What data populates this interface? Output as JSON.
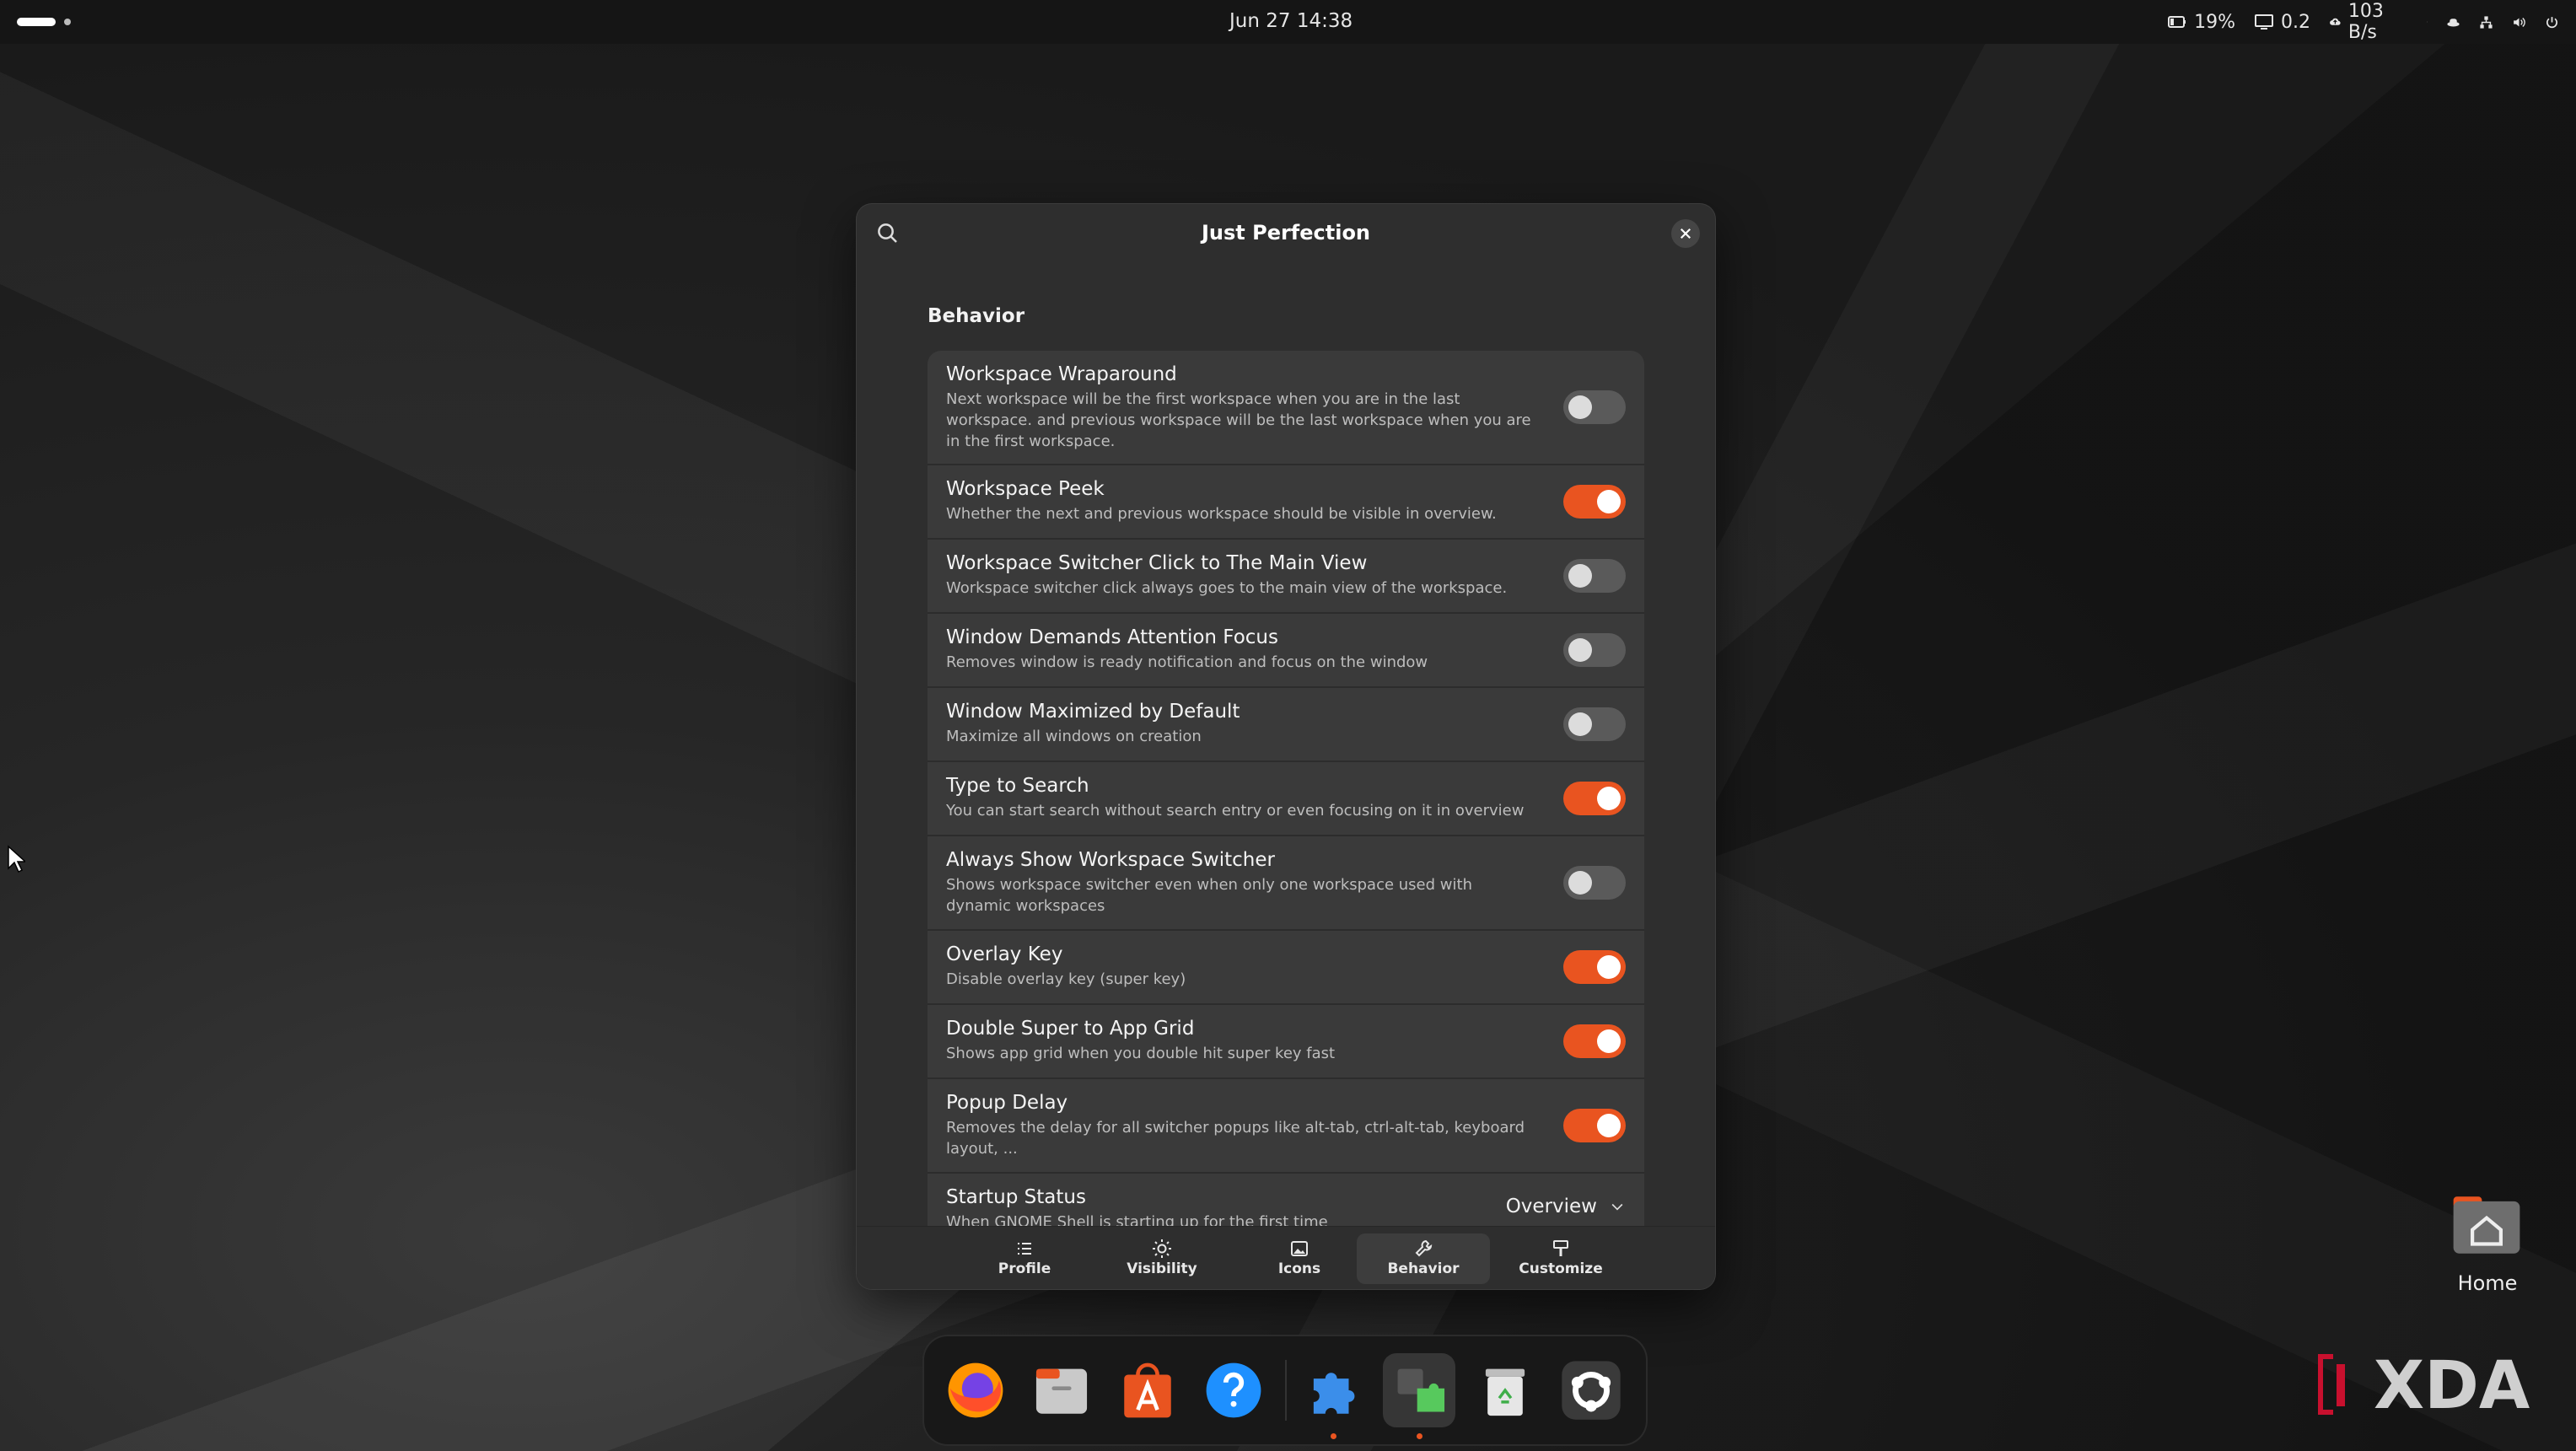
{
  "topbar": {
    "clock": "Jun 27  14:38",
    "status": [
      {
        "icon": "battery-icon",
        "text": "19%"
      },
      {
        "icon": "display-icon",
        "text": "0.2"
      },
      {
        "icon": "cloud-upload-icon",
        "text": "103 B/s"
      }
    ],
    "tray_icons": [
      "screen-share-icon",
      "hat-icon",
      "network-icon",
      "volume-icon",
      "power-icon"
    ]
  },
  "dialog": {
    "title": "Just Perfection",
    "section": "Behavior",
    "rows": [
      {
        "title": "Workspace Wraparound",
        "subtitle": "Next workspace will be the first workspace when you are in the last workspace. and previous workspace will be the last workspace when you are in the first workspace.",
        "enabled": false
      },
      {
        "title": "Workspace Peek",
        "subtitle": "Whether the next and previous workspace should be visible in overview.",
        "enabled": true
      },
      {
        "title": "Workspace Switcher Click to The Main View",
        "subtitle": "Workspace switcher click always goes to the main view of the workspace.",
        "enabled": false
      },
      {
        "title": "Window Demands Attention Focus",
        "subtitle": "Removes window is ready notification and focus on the window",
        "enabled": false
      },
      {
        "title": "Window Maximized by Default",
        "subtitle": "Maximize all windows on creation",
        "enabled": false
      },
      {
        "title": "Type to Search",
        "subtitle": "You can start search without search entry or even focusing on it in overview",
        "enabled": true
      },
      {
        "title": "Always Show Workspace Switcher",
        "subtitle": "Shows workspace switcher even when only one workspace used with dynamic workspaces",
        "enabled": false
      },
      {
        "title": "Overlay Key",
        "subtitle": "Disable overlay key (super key)",
        "enabled": true
      },
      {
        "title": "Double Super to App Grid",
        "subtitle": "Shows app grid when you double hit super key fast",
        "enabled": true
      },
      {
        "title": "Popup Delay",
        "subtitle": "Removes the delay for all switcher popups like alt-tab, ctrl-alt-tab, keyboard layout, ...",
        "enabled": true
      }
    ],
    "startup": {
      "title": "Startup Status",
      "subtitle": "When GNOME Shell is starting up for the first time",
      "value": "Overview"
    },
    "tabs": [
      {
        "label": "Profile",
        "icon": "list-icon"
      },
      {
        "label": "Visibility",
        "icon": "sun-icon"
      },
      {
        "label": "Icons",
        "icon": "image-icon"
      },
      {
        "label": "Behavior",
        "icon": "wrench-icon",
        "active": true
      },
      {
        "label": "Customize",
        "icon": "brush-icon"
      }
    ]
  },
  "dock": {
    "apps": [
      "Firefox",
      "Files",
      "App Center",
      "Help",
      "Extension Manager",
      "Extensions",
      "Trash",
      "Show Apps"
    ]
  },
  "desktop": {
    "home_label": "Home"
  },
  "watermark": "XDA",
  "colors": {
    "accent": "#e95420",
    "dialog_bg": "#2e2e2e",
    "row_bg": "#3a3a3a"
  }
}
